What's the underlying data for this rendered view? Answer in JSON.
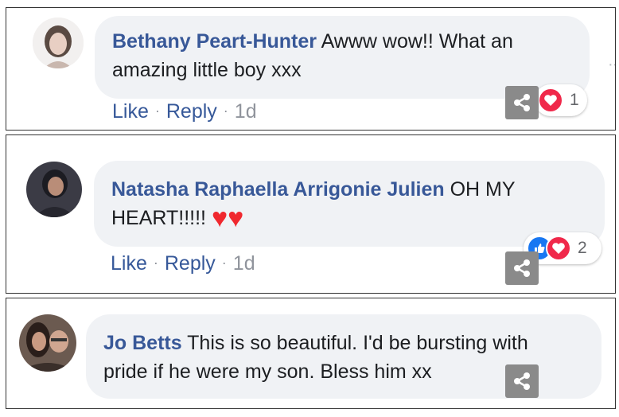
{
  "comments": [
    {
      "author": "Bethany Peart-Hunter",
      "text_line1": "Awww wow!! What an",
      "text_line2": "amazing little boy xxx",
      "actions": {
        "like": "Like",
        "reply": "Reply",
        "time": "1d"
      },
      "reaction_count": "1",
      "reactions": [
        "love-icon"
      ]
    },
    {
      "author": "Natasha Raphaella Arrigonie Julien",
      "text_line1": "OH MY",
      "text_line2": "HEART!!!!!",
      "emoji": "♥♥",
      "actions": {
        "like": "Like",
        "reply": "Reply",
        "time": "1d"
      },
      "reaction_count": "2",
      "reactions": [
        "like-icon",
        "love-icon"
      ]
    },
    {
      "author": "Jo Betts",
      "text_line1": "This is so beautiful. I'd be bursting with",
      "text_line2": "pride if he were my son. Bless him xx"
    }
  ],
  "separator": "·",
  "more_icon": "···",
  "colors": {
    "author": "#385898",
    "bubble": "#f0f2f5",
    "love": "#f0284a",
    "like": "#1877f2",
    "share_button": "#8a8a8a"
  }
}
